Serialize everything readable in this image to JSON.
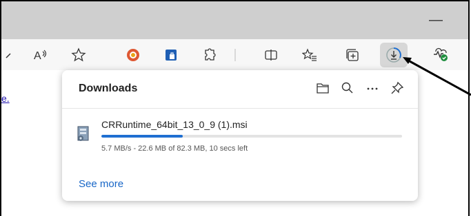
{
  "window": {
    "minimize_label": "—"
  },
  "toolbar": {
    "icons": [
      "search-partial-icon",
      "read-aloud-icon",
      "favorite-star-icon",
      "duckduckgo-icon",
      "extension-shield-icon",
      "extensions-icon",
      "split-screen-icon",
      "favorites-icon",
      "collections-icon",
      "downloads-icon",
      "health-icon"
    ]
  },
  "page": {
    "link_fragment": "e."
  },
  "downloads": {
    "title": "Downloads",
    "file_name": "CRRuntime_64bit_13_0_9 (1).msi",
    "progress_percent": 27,
    "status": "5.7 MB/s - 22.6 MB of 82.3 MB, 10 secs left",
    "see_more": "See more",
    "accent_color": "#1f6fd1"
  }
}
